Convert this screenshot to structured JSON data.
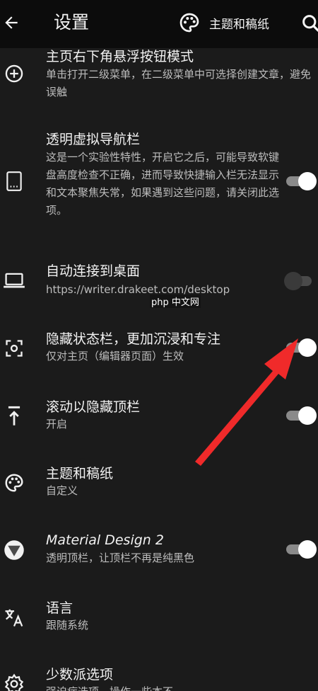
{
  "header": {
    "back_icon": "arrow-left-icon",
    "title": "设置",
    "theme_icon": "palette-icon",
    "theme_label": "主题和稿纸",
    "search_icon": "search-icon"
  },
  "settings": [
    {
      "icon": "plus-circle-icon",
      "title": "主页右下角悬浮按钮模式",
      "subtitle": "单击打开二级菜单，在二级菜单中可选择创建文章，避免误触",
      "toggle": null
    },
    {
      "icon": "tablet-icon",
      "title": "透明虚拟导航栏",
      "subtitle": "这是一个实验性特性，开启它之后，可能导致软键盘高度检查不正确，进而导致快捷输入栏无法显示和文本聚焦失常，如果遇到这些问题，请关闭此选项。",
      "toggle": true
    },
    {
      "icon": "laptop-icon",
      "title": "自动连接到桌面",
      "subtitle": "https://writer.drakeet.com/desktop",
      "toggle": false
    },
    {
      "icon": "fullscreen-icon",
      "title": "隐藏状态栏，更加沉浸和专注",
      "subtitle": "仅对主页（编辑器页面）生效",
      "toggle": true
    },
    {
      "icon": "scroll-up-icon",
      "title": "滚动以隐藏顶栏",
      "subtitle": "开启",
      "toggle": true
    },
    {
      "icon": "palette-icon",
      "title": "主题和稿纸",
      "subtitle": "自定义",
      "toggle": null
    },
    {
      "icon": "material-design-icon",
      "title": "Material Design 2",
      "subtitle": "透明顶栏，让顶栏不再是纯黑色",
      "toggle": true
    },
    {
      "icon": "translate-icon",
      "title": "语言",
      "subtitle": "跟随系统",
      "toggle": null
    },
    {
      "icon": "gear-icon",
      "title": "少数派选项",
      "subtitle": "强迫症选项，操作一些本不",
      "toggle": null
    }
  ],
  "watermark": "php 中文网",
  "colors": {
    "background": "#1b1b1b",
    "toolbar": "#0c0c0c",
    "switch_on_thumb": "#ffffff",
    "annotation_arrow": "#f02a2a"
  }
}
